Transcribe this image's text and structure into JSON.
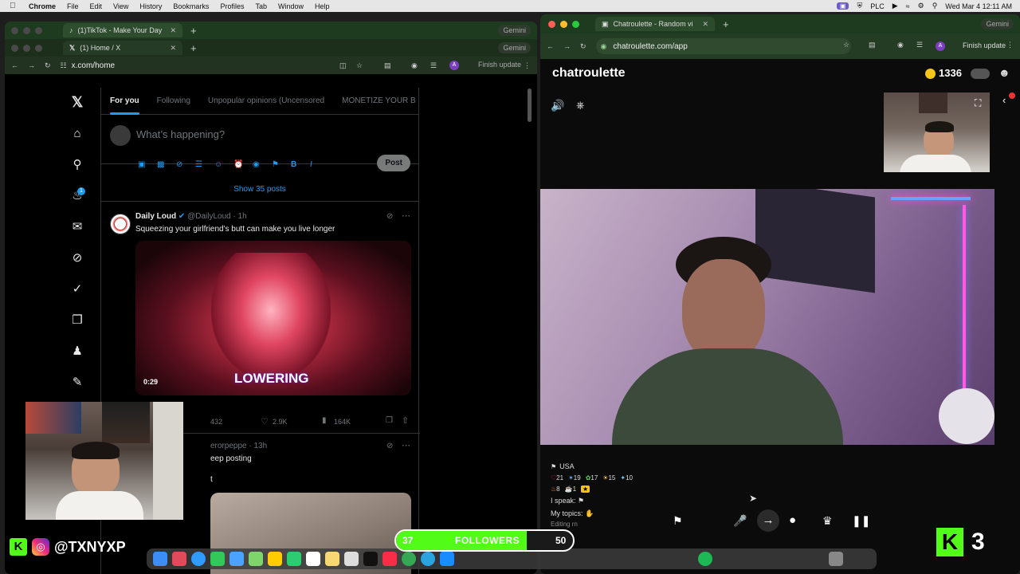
{
  "menubar": {
    "app": "Chrome",
    "items": [
      "File",
      "Edit",
      "View",
      "History",
      "Bookmarks",
      "Profiles",
      "Tab",
      "Window",
      "Help"
    ],
    "plc": "PLC",
    "datetime": "Wed Mar 4  12:11 AM"
  },
  "left_browser": {
    "back_tab": "(1)TikTok - Make Your Day",
    "front_tab": "(1) Home / X",
    "gemini": "Gemini",
    "url": "x.com/home",
    "avatar_letter": "A",
    "finish_update": "Finish update"
  },
  "x_timeline": {
    "tabs": [
      "For you",
      "Following",
      "Unpopular opinions (Uncensored",
      "MONETIZE YOUR B"
    ],
    "compose_placeholder": "What’s happening?",
    "post_label": "Post",
    "show_posts": "Show 35 posts",
    "tweet1": {
      "name": "Daily Loud",
      "handle": "@DailyLoud · 1h",
      "text": "Squeezing your girlfriend's butt can make you live longer",
      "video_time": "0:29",
      "video_caption": "LOWERING",
      "replies": "432",
      "likes": "2.9K",
      "views": "164K"
    },
    "tweet2": {
      "handle": "erorpeppe · 13h",
      "text": "eep posting",
      "text2": "t"
    }
  },
  "right_browser": {
    "tab": "Chatroulette - Random vi",
    "gemini": "Gemini",
    "url": "chatroulette.com/app",
    "avatar_letter": "A",
    "finish_update": "Finish update"
  },
  "chatroulette": {
    "logo": "chatroulette",
    "coins": "1336",
    "country": "USA",
    "stats_row1": [
      "21",
      "19",
      "17",
      "15",
      "10"
    ],
    "stats_row2": [
      "8",
      "1"
    ],
    "i_speak": "I speak:",
    "my_topics": "My topics:",
    "editing": "Editing rn"
  },
  "overlay": {
    "handle": "@TXNYXP",
    "followers_current": "37",
    "followers_label": "FOLLOWERS",
    "followers_goal": "50",
    "kick_count": "3"
  },
  "colors": {
    "x_blue": "#1d9bf0",
    "kick_green": "#53fc18",
    "chrome_green": "#1f3b1f"
  }
}
